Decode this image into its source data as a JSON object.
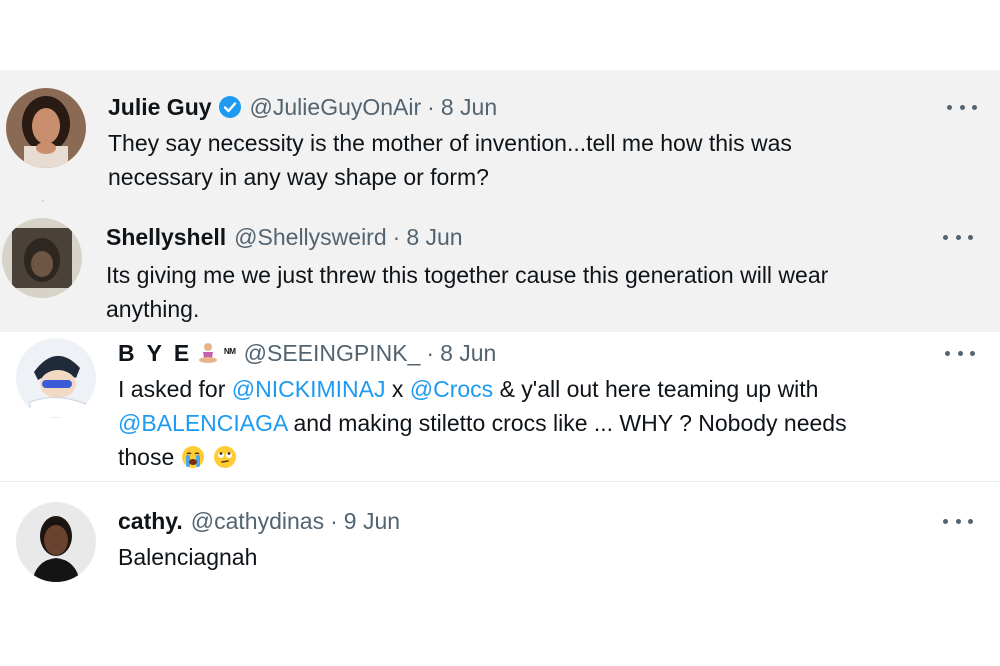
{
  "tweets": [
    {
      "name": "Julie Guy",
      "handle": "@JulieGuyOnAir",
      "separator": "·",
      "time": "8 Jun",
      "verified": true,
      "text_line1": "They say necessity is the mother of invention...tell me how this was",
      "text_line2": "necessary in any way shape or form?"
    },
    {
      "name": "Shellyshell",
      "handle": "@Shellysweird",
      "separator": "·",
      "time": "8 Jun",
      "text_line1": "Its giving me we just threw this together cause this generation will wear",
      "text_line2": "anything."
    },
    {
      "name": "B Y E",
      "name_suffix": "ᴺᴹ",
      "handle": "@SEEINGPINK_",
      "separator": "·",
      "time": "8 Jun",
      "text_part1": "I asked for ",
      "mention1": "@NICKIMINAJ",
      "text_part2": " x ",
      "mention2": "@Crocs",
      "text_part3": " & y'all out here teaming up with",
      "mention3": "@BALENCIAGA",
      "text_part4": " and making stiletto crocs like ... WHY ? Nobody needs",
      "text_part5": "those"
    },
    {
      "name": "cathy.",
      "handle": "@cathydinas",
      "separator": "·",
      "time": "9 Jun",
      "text_line1": "Balenciagnah"
    }
  ],
  "icons": {
    "verified": "verified-badge-icon",
    "more": "more-options-icon",
    "meditation_emoji": "person-in-lotus-position-emoji",
    "crying_emoji": "loudly-crying-face-emoji",
    "eye_roll_emoji": "face-with-rolling-eyes-emoji"
  },
  "colors": {
    "mention": "#1d9bf0",
    "secondary_text": "#536471",
    "shaded_background": "#f2f2f2",
    "verified": "#1d9bf0"
  }
}
